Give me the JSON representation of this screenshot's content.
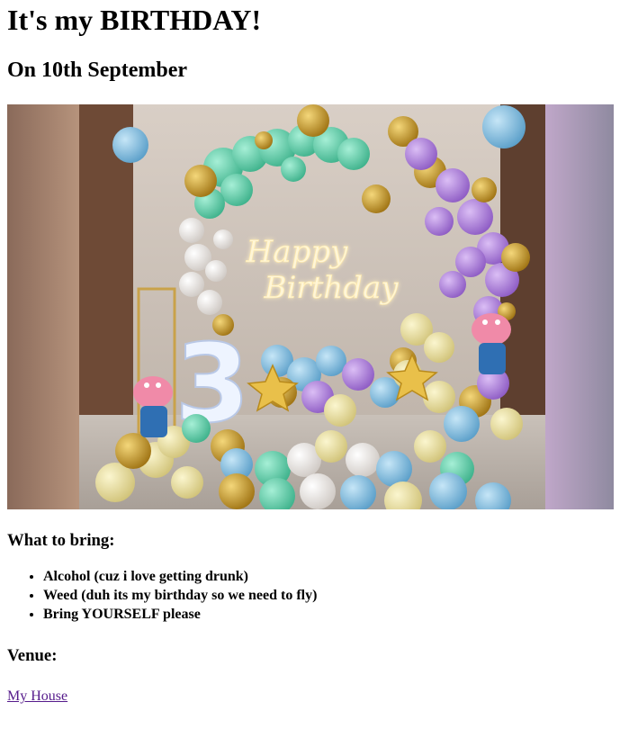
{
  "page": {
    "title": "It's my BIRTHDAY!",
    "date_heading": "On 10th September",
    "hero_image": {
      "sign_text_line1": "Happy",
      "sign_text_line2": "Birthday",
      "number": "3"
    },
    "bring": {
      "heading": "What to bring:",
      "items": [
        "Alcohol (cuz i love getting drunk)",
        "Weed (duh its my birthday so we need to fly)",
        "Bring YOURSELF please"
      ]
    },
    "venue": {
      "heading": "Venue:",
      "link_text": "My House"
    }
  },
  "colors": {
    "link": "#551a8b",
    "text": "#000000",
    "mint": "#6fd3b0",
    "lavender": "#b58be0",
    "gold": "#c99a2e",
    "sky": "#8fc6e6",
    "cream": "#efe6a8",
    "pink": "#f08aa8"
  }
}
